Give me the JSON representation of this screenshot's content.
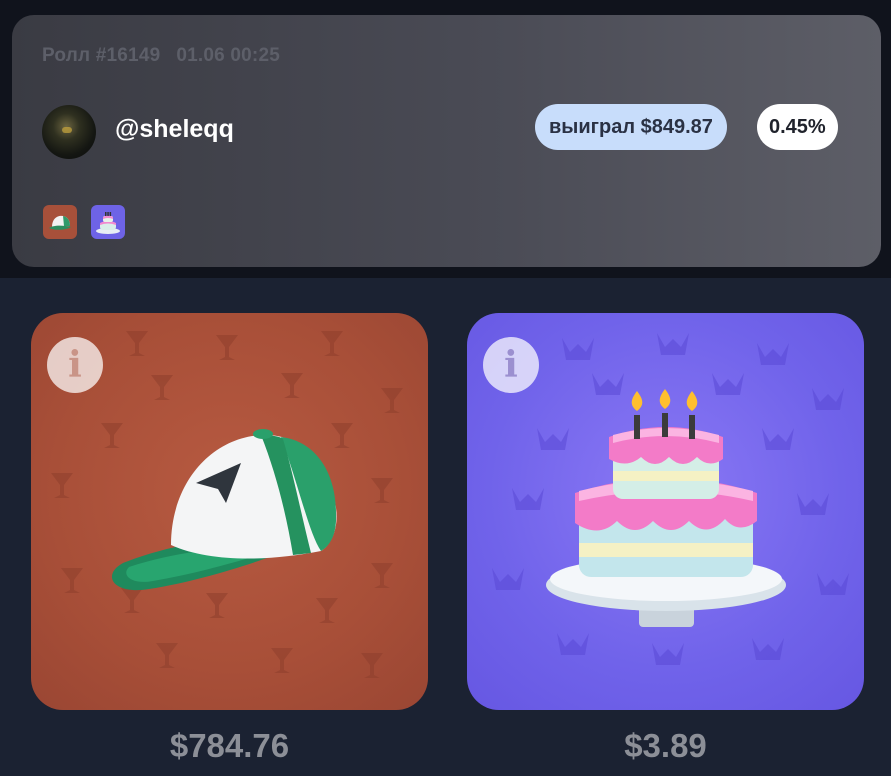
{
  "roll": {
    "label": "Ролл #16149",
    "datetime": "01.06 00:25",
    "username": "@sheleqq",
    "win_badge": "выиграл $849.87",
    "chance": "0.45%"
  },
  "items": [
    {
      "name": "cap",
      "icon": "cap-icon",
      "price": "$784.76",
      "bg": "#a84f38"
    },
    {
      "name": "cake",
      "icon": "cake-icon",
      "price": "$3.89",
      "bg": "#7063ea"
    }
  ],
  "info_icon": "i",
  "colors": {
    "page_bg": "#1b2232",
    "card_bg": "#44454e",
    "win_badge_bg": "#c8ddfb",
    "chance_badge_bg": "#ffffff"
  }
}
